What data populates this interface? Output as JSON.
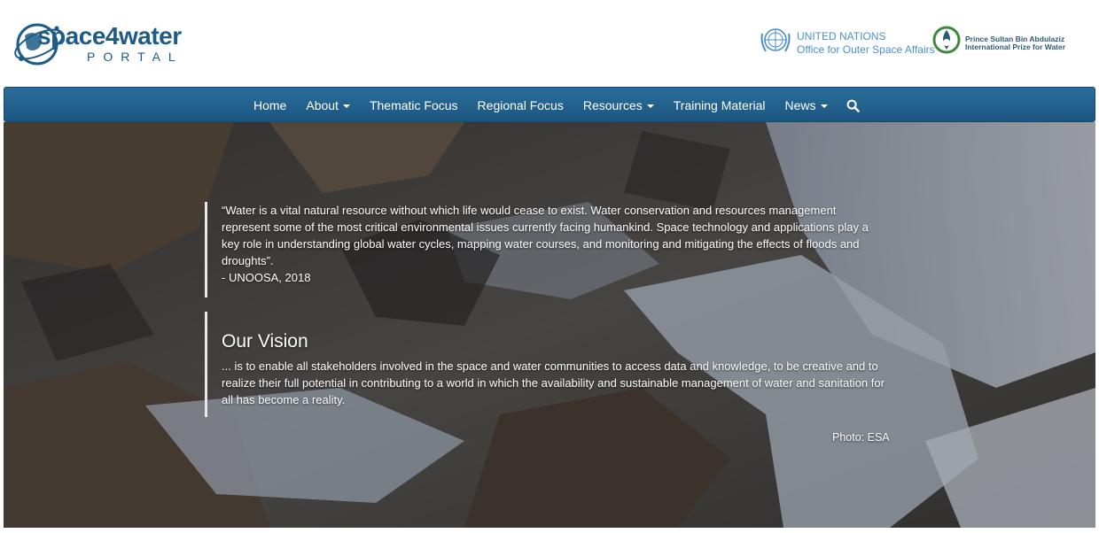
{
  "header": {
    "logo": {
      "word": "space4water",
      "sub": "PORTAL"
    },
    "un": {
      "line1": "UNITED NATIONS",
      "line2": "Office for Outer Space Affairs"
    },
    "prize": {
      "line1": "Prince Sultan Bin Abdulaziz",
      "line2": "International Prize for Water"
    }
  },
  "nav": {
    "items": [
      {
        "label": "Home",
        "dropdown": false
      },
      {
        "label": "About",
        "dropdown": true
      },
      {
        "label": "Thematic Focus",
        "dropdown": false
      },
      {
        "label": "Regional Focus",
        "dropdown": false
      },
      {
        "label": "Resources",
        "dropdown": true
      },
      {
        "label": "Training Material",
        "dropdown": false
      },
      {
        "label": "News",
        "dropdown": true
      }
    ],
    "search_icon": "search-icon"
  },
  "hero": {
    "quote": "“Water is a vital natural resource without which life would cease to exist. Water conservation and resources management represent some of the most critical environmental issues currently facing humankind. Space technology and applications play a key role in understanding global water cycles, mapping water courses, and monitoring and mitigating the effects of floods and droughts”.",
    "quote_source": "- UNOOSA, 2018",
    "vision_title": "Our Vision",
    "vision_text": "... is to enable all stakeholders involved in the space and water communities to access data and knowledge, to be creative and to realize their full potential in contributing to a world in which the availability and sustainable management of water and sanitation for all has become a reality.",
    "photo_credit": "Photo: ESA"
  },
  "colors": {
    "brand": "#1e5b86",
    "nav_bg": "#245f8a",
    "un_blue": "#4a8fd0"
  }
}
